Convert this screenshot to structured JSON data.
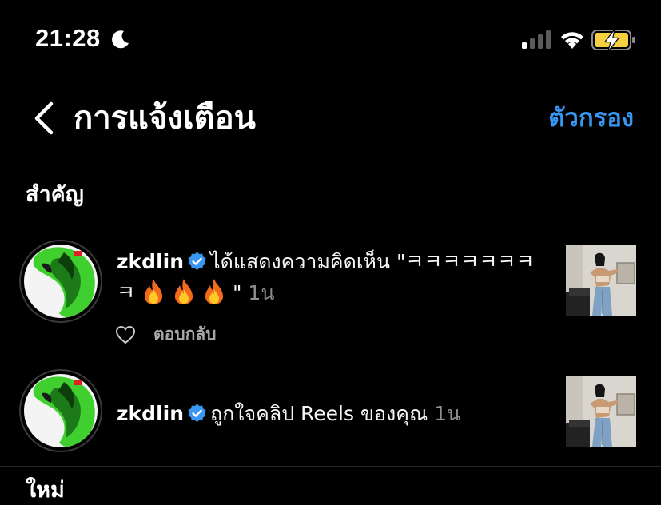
{
  "status_bar": {
    "time": "21:28",
    "moon_icon": "moon-icon",
    "signal_icon": "cellular-signal-icon",
    "wifi_icon": "wifi-icon",
    "battery_icon": "battery-charging-icon",
    "battery_color": "#f5d142"
  },
  "header": {
    "back_icon": "chevron-left-icon",
    "title": "การแจ้งเตือน",
    "filter_label": "ตัวกรอง",
    "accent_color": "#3897f0"
  },
  "sections": {
    "important": "สำคัญ",
    "new": "ใหม่"
  },
  "notifications": [
    {
      "username": "zkdlin",
      "verified_icon": "verified-badge-icon",
      "action": "ได้แสดงความคิดเห็น \"ㅋㅋㅋㅋㅋㅋㅋㅋ",
      "after_emoji": "\"",
      "emoji_icons": [
        "fire-icon",
        "fire-icon",
        "fire-icon"
      ],
      "time": "1น",
      "like_icon": "heart-outline-icon",
      "reply_label": "ตอบกลับ"
    },
    {
      "username": "zkdlin",
      "verified_icon": "verified-badge-icon",
      "action": "ถูกใจคลิป Reels ของคุณ",
      "time": "1น"
    }
  ]
}
